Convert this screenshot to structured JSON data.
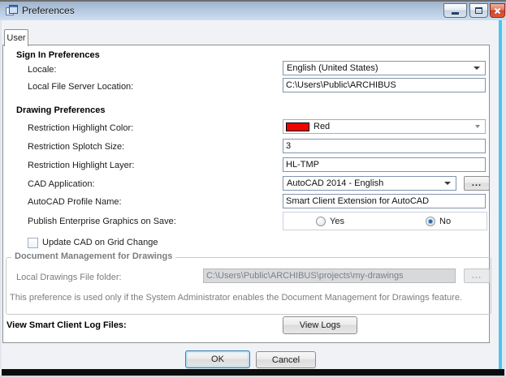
{
  "titlebar": {
    "title": "Preferences"
  },
  "window_controls": {
    "minimize": "minimize-icon",
    "maximize": "maximize-icon",
    "close": "close-icon"
  },
  "tab": {
    "label": "User"
  },
  "sign_in": {
    "heading": "Sign In Preferences",
    "locale_label": "Locale:",
    "locale_value": "English (United States)",
    "file_server_label": "Local File Server Location:",
    "file_server_value": "C:\\Users\\Public\\ARCHIBUS"
  },
  "drawing": {
    "heading": "Drawing Preferences",
    "highlight_color_label": "Restriction Highlight Color:",
    "highlight_color_value": "Red",
    "splotch_size_label": "Restriction Splotch Size:",
    "splotch_size_value": "3",
    "highlight_layer_label": "Restriction Highlight Layer:",
    "highlight_layer_value": "HL-TMP",
    "cad_app_label": "CAD Application:",
    "cad_app_value": "AutoCAD 2014 - English",
    "browse_label": "...",
    "profile_label": "AutoCAD Profile Name:",
    "profile_value": "Smart Client Extension for AutoCAD",
    "publish_label": "Publish Enterprise Graphics on Save:",
    "radio_yes_label": "Yes",
    "radio_no_label": "No",
    "publish_selected": "No",
    "update_cad_label": "Update CAD on Grid Change",
    "update_cad_checked": false
  },
  "doc_mgmt": {
    "group_label": "Document Management for Drawings",
    "folder_label": "Local Drawings File folder:",
    "folder_value": "C:\\Users\\Public\\ARCHIBUS\\projects\\my-drawings",
    "browse_label": "...",
    "note": "This preference is used only if the System Administrator enables the Document Management for Drawings feature."
  },
  "logs": {
    "label": "View Smart Client Log Files:",
    "button_label": "View Logs"
  },
  "footer": {
    "ok_label": "OK",
    "cancel_label": "Cancel"
  },
  "colors": {
    "highlight_swatch": "#ee0202",
    "accent_frame": "#4fc2f3",
    "radio_selected": "#2a66a5"
  }
}
